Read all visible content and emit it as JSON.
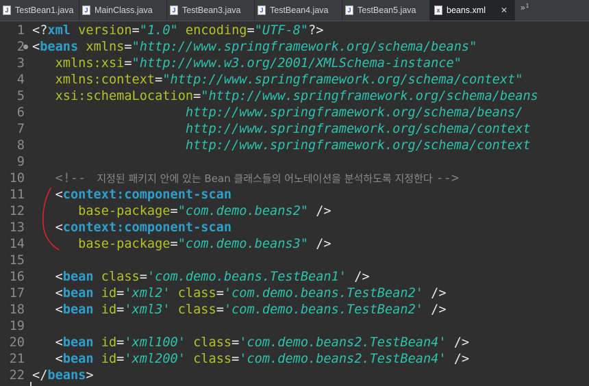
{
  "tabs": [
    {
      "label": "TestBean1.java",
      "icon": "java-file-icon",
      "active": false
    },
    {
      "label": "MainClass.java",
      "icon": "java-file-icon",
      "active": false
    },
    {
      "label": "TestBean3.java",
      "icon": "java-file-icon",
      "active": false
    },
    {
      "label": "TestBean4.java",
      "icon": "java-file-icon",
      "active": false
    },
    {
      "label": "TestBean5.java",
      "icon": "java-file-icon",
      "active": false
    },
    {
      "label": "beans.xml",
      "icon": "xml-file-icon",
      "active": true
    }
  ],
  "tab_close_glyph": "✕",
  "overflow": {
    "glyph": "»",
    "count": "1"
  },
  "line_numbers": [
    "1",
    "2",
    "3",
    "4",
    "5",
    "6",
    "7",
    "8",
    "9",
    "10",
    "11",
    "12",
    "13",
    "14",
    "15",
    "16",
    "17",
    "18",
    "19",
    "20",
    "21",
    "22"
  ],
  "lines": [
    [
      [
        "p",
        "<?"
      ],
      [
        "t",
        "xml"
      ],
      [
        "a",
        " version"
      ],
      [
        "p",
        "="
      ],
      [
        "v",
        "\"1.0\""
      ],
      [
        "a",
        " encoding"
      ],
      [
        "p",
        "="
      ],
      [
        "v",
        "\"UTF-8\""
      ],
      [
        "p",
        "?>"
      ]
    ],
    [
      [
        "p",
        "<"
      ],
      [
        "t",
        "beans"
      ],
      [
        "a",
        " xmlns"
      ],
      [
        "p",
        "="
      ],
      [
        "v",
        "\"http://www.springframework.org/schema/beans\""
      ]
    ],
    [
      [
        "a",
        "   xmlns:xsi"
      ],
      [
        "p",
        "="
      ],
      [
        "v",
        "\"http://www.w3.org/2001/XMLSchema-instance\""
      ]
    ],
    [
      [
        "a",
        "   xmlns:context"
      ],
      [
        "p",
        "="
      ],
      [
        "v",
        "\"http://www.springframework.org/schema/context\""
      ]
    ],
    [
      [
        "a",
        "   xsi:schemaLocation"
      ],
      [
        "p",
        "="
      ],
      [
        "v",
        "\"http://www.springframework.org/schema/beans"
      ]
    ],
    [
      [
        "v",
        "                    http://www.springframework.org/schema/beans/"
      ]
    ],
    [
      [
        "v",
        "                    http://www.springframework.org/schema/context"
      ]
    ],
    [
      [
        "v",
        "                    http://www.springframework.org/schema/context"
      ]
    ],
    [],
    [
      [
        "c",
        "   <!-- "
      ],
      [
        "cm",
        " 지정된 패키지 안에 있는 Bean 클래스들의 어노테이션을 분석하도록 지정한다 "
      ],
      [
        "c",
        "-->"
      ]
    ],
    [
      [
        "p",
        "   <"
      ],
      [
        "t",
        "context:component-scan"
      ]
    ],
    [
      [
        "a",
        "      base-package"
      ],
      [
        "p",
        "="
      ],
      [
        "v",
        "\"com.demo.beans2\""
      ],
      [
        "p",
        " />"
      ]
    ],
    [
      [
        "p",
        "   <"
      ],
      [
        "t",
        "context:component-scan"
      ]
    ],
    [
      [
        "a",
        "      base-package"
      ],
      [
        "p",
        "="
      ],
      [
        "v",
        "\"com.demo.beans3\""
      ],
      [
        "p",
        " />"
      ]
    ],
    [],
    [
      [
        "p",
        "   <"
      ],
      [
        "t",
        "bean"
      ],
      [
        "a",
        " class"
      ],
      [
        "p",
        "="
      ],
      [
        "v",
        "'com.demo.beans.TestBean1'"
      ],
      [
        "p",
        " />"
      ]
    ],
    [
      [
        "p",
        "   <"
      ],
      [
        "t",
        "bean"
      ],
      [
        "a",
        " id"
      ],
      [
        "p",
        "="
      ],
      [
        "v",
        "'xml2'"
      ],
      [
        "a",
        " class"
      ],
      [
        "p",
        "="
      ],
      [
        "v",
        "'com.demo.beans.TestBean2'"
      ],
      [
        "p",
        " />"
      ]
    ],
    [
      [
        "p",
        "   <"
      ],
      [
        "t",
        "bean"
      ],
      [
        "a",
        " id"
      ],
      [
        "p",
        "="
      ],
      [
        "v",
        "'xml3'"
      ],
      [
        "a",
        " class"
      ],
      [
        "p",
        "="
      ],
      [
        "v",
        "'com.demo.beans.TestBean2'"
      ],
      [
        "p",
        " />"
      ]
    ],
    [],
    [
      [
        "p",
        "   <"
      ],
      [
        "t",
        "bean"
      ],
      [
        "a",
        " id"
      ],
      [
        "p",
        "="
      ],
      [
        "v",
        "'xml100'"
      ],
      [
        "a",
        " class"
      ],
      [
        "p",
        "="
      ],
      [
        "v",
        "'com.demo.beans2.TestBean4'"
      ],
      [
        "p",
        " />"
      ]
    ],
    [
      [
        "p",
        "   <"
      ],
      [
        "t",
        "bean"
      ],
      [
        "a",
        " id"
      ],
      [
        "p",
        "="
      ],
      [
        "v",
        "'xml200'"
      ],
      [
        "a",
        " class"
      ],
      [
        "p",
        "="
      ],
      [
        "v",
        "'com.demo.beans2.TestBean4'"
      ],
      [
        "p",
        " />"
      ]
    ],
    [
      [
        "p",
        "</"
      ],
      [
        "t",
        "beans"
      ],
      [
        "p",
        ">"
      ]
    ]
  ],
  "folded_lines": [
    2
  ],
  "colors": {
    "background": "#2f2f2f",
    "tag": "#2fa0cc",
    "attribute": "#b4c22a",
    "value": "#2fc2b0",
    "punctuation": "#e8e8e8",
    "comment": "#8a8a8a",
    "annotation_stroke": "#e0222a"
  }
}
